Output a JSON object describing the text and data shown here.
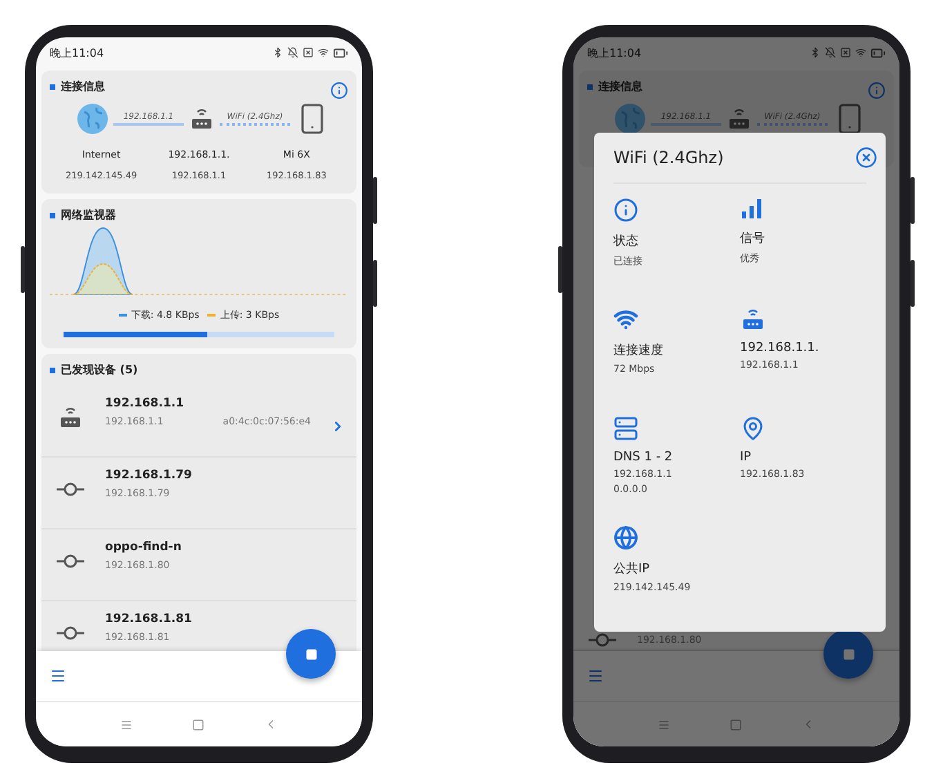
{
  "main_screen": {
    "status": {
      "time": "晚上11:04"
    },
    "connection": {
      "title": "连接信息",
      "nodes": [
        {
          "kind": "globe",
          "name": "Internet",
          "ip": "219.142.145.49"
        },
        {
          "kind": "router",
          "name": "192.168.1.1.",
          "ip": "192.168.1.1"
        },
        {
          "kind": "phone",
          "name": "Mi 6X",
          "ip": "192.168.1.83"
        }
      ],
      "links": [
        {
          "label": "192.168.1.1"
        },
        {
          "label": "WiFi (2.4Ghz)"
        }
      ]
    },
    "monitor": {
      "title": "网络监视器",
      "legend": [
        {
          "label": "下载: 4.8 KBps",
          "color": "#3d8fe0"
        },
        {
          "label": "上传: 3 KBps",
          "color": "#f0b030"
        }
      ],
      "progress": {
        "level": 0.53
      }
    },
    "devices": {
      "title": "已发现设备 (5)",
      "items": [
        {
          "kind": "router",
          "name": "192.168.1.1",
          "ip": "192.168.1.1",
          "mac": "a0:4c:0c:07:56:e4",
          "has_detail": true
        },
        {
          "kind": "node",
          "name": "192.168.1.79",
          "ip": "192.168.1.79",
          "has_detail": false
        },
        {
          "kind": "node",
          "name": "oppo-find-n",
          "ip": "192.168.1.80",
          "has_detail": false
        },
        {
          "kind": "node",
          "name": "192.168.1.81",
          "ip": "192.168.1.81",
          "has_detail": false
        }
      ]
    }
  },
  "dialog_screen": {
    "background": {
      "status": {
        "time": "晚上11:04"
      },
      "section_title": "连接信息",
      "nodes": [
        {
          "kind": "globe"
        },
        {
          "kind": "router"
        },
        {
          "kind": "phone"
        }
      ],
      "links": [
        {
          "label": "192.168.1.1"
        },
        {
          "label": "WiFi (2.4Ghz)"
        }
      ],
      "partial_row": {
        "kind": "node",
        "ip": "192.168.1.80"
      }
    },
    "dialog": {
      "title": "WiFi (2.4Ghz)",
      "items": [
        {
          "kind": "info",
          "label": "状态",
          "values": [
            "已连接"
          ]
        },
        {
          "kind": "signal",
          "label": "信号",
          "values": [
            "优秀"
          ]
        },
        {
          "kind": "wifi",
          "label": "连接速度",
          "values": [
            "72 Mbps"
          ]
        },
        {
          "kind": "router",
          "label": "192.168.1.1.",
          "values": [
            "192.168.1.1"
          ]
        },
        {
          "kind": "dns",
          "label": "DNS 1 - 2",
          "values": [
            "192.168.1.1",
            "0.0.0.0"
          ]
        },
        {
          "kind": "ip",
          "label": "IP",
          "values": [
            "192.168.1.83"
          ]
        },
        {
          "kind": "globe",
          "label": "公共IP",
          "values": [
            "219.142.145.49"
          ]
        }
      ]
    }
  }
}
